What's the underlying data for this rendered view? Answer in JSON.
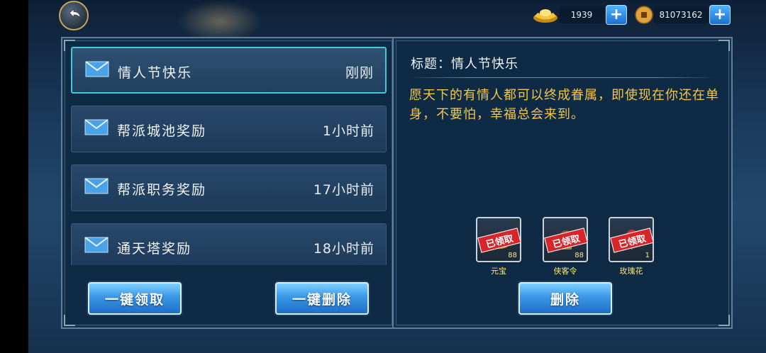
{
  "header": {
    "back_icon": "back-arrow-icon",
    "ingot": {
      "icon": "gold-ingot-icon",
      "value": "1939",
      "plus": "+"
    },
    "coin": {
      "icon": "coin-icon",
      "value": "81073162",
      "plus": "+"
    }
  },
  "mail_list": [
    {
      "title": "情人节快乐",
      "time": "刚刚",
      "selected": true
    },
    {
      "title": "帮派城池奖励",
      "time": "1小时前",
      "selected": false
    },
    {
      "title": "帮派职务奖励",
      "time": "17小时前",
      "selected": false
    },
    {
      "title": "通天塔奖励",
      "time": "18小时前",
      "selected": false
    }
  ],
  "buttons": {
    "claim_all": "一键领取",
    "delete_all": "一键删除",
    "delete": "删除"
  },
  "detail": {
    "title": "标题：情人节快乐",
    "body": "愿天下的有情人都可以终成眷属，即使现在你还在单身，不要怕，幸福总会来到。"
  },
  "attachments": [
    {
      "name": "元宝",
      "qty": "88",
      "stamp": "已领取",
      "icon": "ingot-item-icon"
    },
    {
      "name": "侠客令",
      "qty": "88",
      "stamp": "已领取",
      "icon": "token-item-icon"
    },
    {
      "name": "玫瑰花",
      "qty": "1",
      "stamp": "已领取",
      "icon": "rose-item-icon"
    }
  ],
  "colors": {
    "accent_blue": "#3a97e6",
    "body_text": "#f2c64a",
    "selected_border": "#47c7d8",
    "claimed_stamp": "#d6262b"
  }
}
